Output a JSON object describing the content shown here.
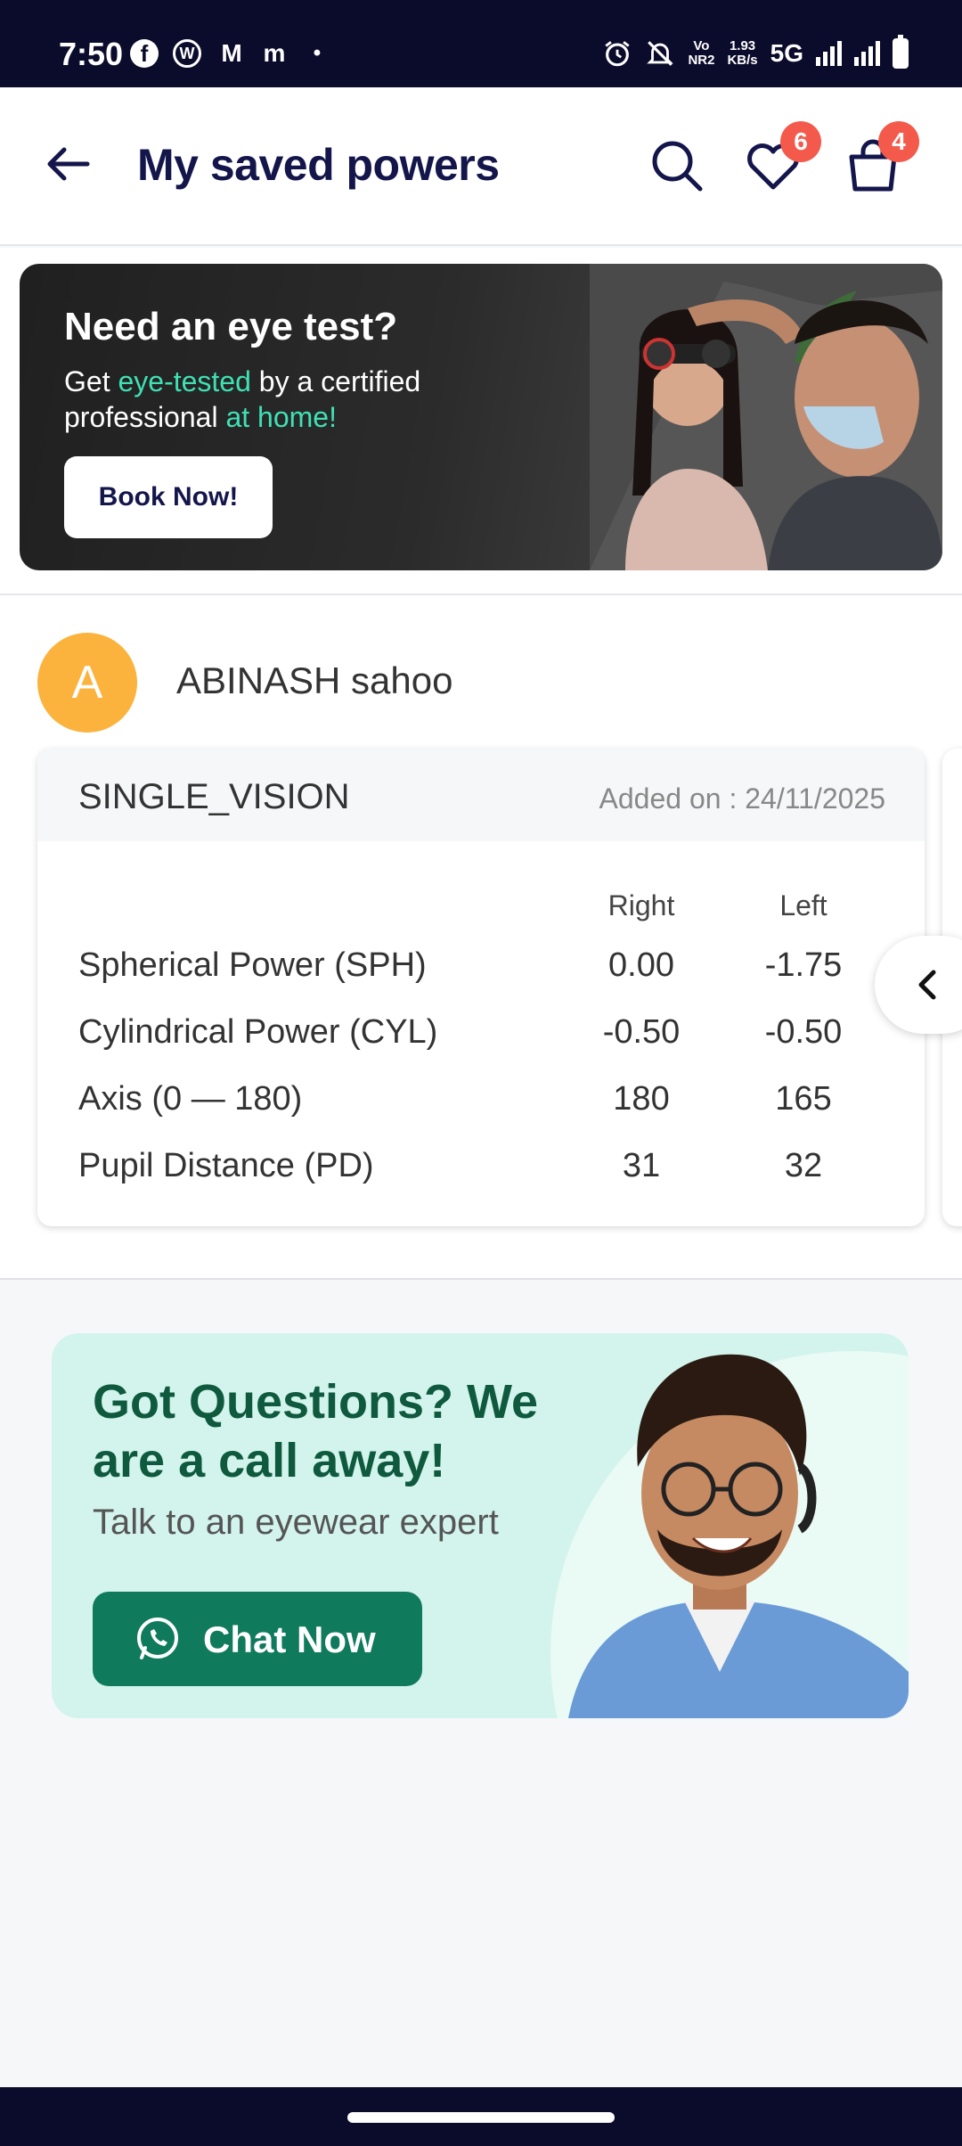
{
  "status_bar": {
    "time": "7:50",
    "apps": [
      "f",
      "W",
      "M",
      "m"
    ],
    "dot": "•",
    "net_speed_top": "1.93",
    "net_speed_bottom": "KB/s",
    "vo_top": "Vo",
    "vo_bottom": "NR2",
    "network": "5G"
  },
  "header": {
    "title": "My saved powers",
    "wishlist_count": "6",
    "cart_count": "4"
  },
  "banner": {
    "title": "Need an eye test?",
    "sub_part1": "Get ",
    "sub_highlight1": "eye-tested",
    "sub_part2": " by a certified professional ",
    "sub_highlight2": "at home!",
    "button_label": "Book Now!"
  },
  "profile": {
    "initial": "A",
    "name": "ABINASH sahoo"
  },
  "prescription": {
    "lens_type": "SINGLE_VISION",
    "added_on": "Added on : 24/11/2025",
    "col_right": "Right",
    "col_left": "Left",
    "rows": [
      {
        "label": "Spherical Power (SPH)",
        "right": "0.00",
        "left": "-1.75"
      },
      {
        "label": "Cylindrical Power (CYL)",
        "right": "-0.50",
        "left": "-0.50"
      },
      {
        "label": "Axis (0 — 180)",
        "right": "180",
        "left": "165"
      },
      {
        "label": "Pupil Distance (PD)",
        "right": "31",
        "left": "32"
      }
    ]
  },
  "help": {
    "title": "Got Questions? We are a call away!",
    "subtitle": "Talk to an eyewear expert",
    "button_label": "Chat Now"
  },
  "colors": {
    "header_title": "#14164b",
    "badge": "#f45a4c",
    "avatar": "#fbb33e",
    "banner_highlight": "#3fe0b4",
    "help_bg": "#d3f4ec",
    "chat_button": "#0f7a5c"
  },
  "icons": [
    "back-arrow-icon",
    "search-icon",
    "heart-icon",
    "bag-icon",
    "chevron-left-icon",
    "whatsapp-icon",
    "alarm-icon",
    "bell-off-icon",
    "signal-icon",
    "battery-icon"
  ]
}
